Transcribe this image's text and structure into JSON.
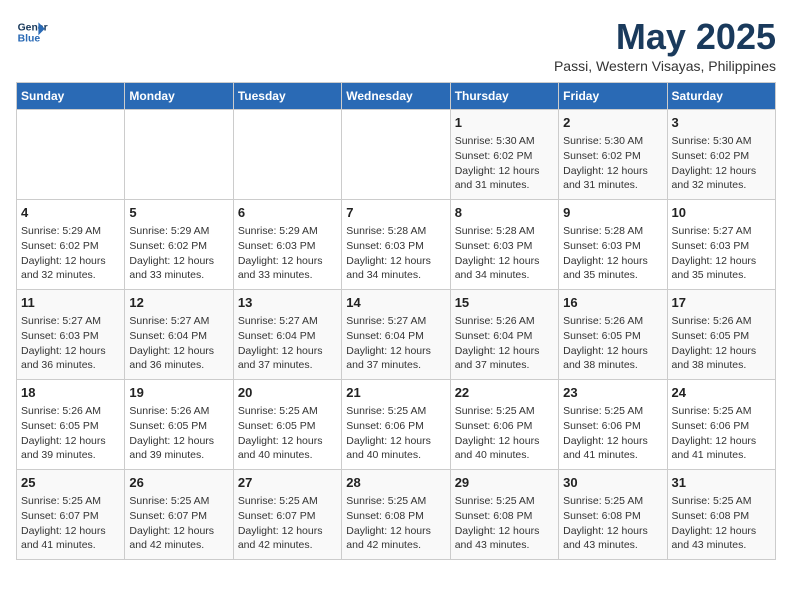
{
  "logo": {
    "line1": "General",
    "line2": "Blue"
  },
  "title": "May 2025",
  "subtitle": "Passi, Western Visayas, Philippines",
  "weekdays": [
    "Sunday",
    "Monday",
    "Tuesday",
    "Wednesday",
    "Thursday",
    "Friday",
    "Saturday"
  ],
  "weeks": [
    [
      {
        "day": "",
        "info": ""
      },
      {
        "day": "",
        "info": ""
      },
      {
        "day": "",
        "info": ""
      },
      {
        "day": "",
        "info": ""
      },
      {
        "day": "1",
        "info": "Sunrise: 5:30 AM\nSunset: 6:02 PM\nDaylight: 12 hours\nand 31 minutes."
      },
      {
        "day": "2",
        "info": "Sunrise: 5:30 AM\nSunset: 6:02 PM\nDaylight: 12 hours\nand 31 minutes."
      },
      {
        "day": "3",
        "info": "Sunrise: 5:30 AM\nSunset: 6:02 PM\nDaylight: 12 hours\nand 32 minutes."
      }
    ],
    [
      {
        "day": "4",
        "info": "Sunrise: 5:29 AM\nSunset: 6:02 PM\nDaylight: 12 hours\nand 32 minutes."
      },
      {
        "day": "5",
        "info": "Sunrise: 5:29 AM\nSunset: 6:02 PM\nDaylight: 12 hours\nand 33 minutes."
      },
      {
        "day": "6",
        "info": "Sunrise: 5:29 AM\nSunset: 6:03 PM\nDaylight: 12 hours\nand 33 minutes."
      },
      {
        "day": "7",
        "info": "Sunrise: 5:28 AM\nSunset: 6:03 PM\nDaylight: 12 hours\nand 34 minutes."
      },
      {
        "day": "8",
        "info": "Sunrise: 5:28 AM\nSunset: 6:03 PM\nDaylight: 12 hours\nand 34 minutes."
      },
      {
        "day": "9",
        "info": "Sunrise: 5:28 AM\nSunset: 6:03 PM\nDaylight: 12 hours\nand 35 minutes."
      },
      {
        "day": "10",
        "info": "Sunrise: 5:27 AM\nSunset: 6:03 PM\nDaylight: 12 hours\nand 35 minutes."
      }
    ],
    [
      {
        "day": "11",
        "info": "Sunrise: 5:27 AM\nSunset: 6:03 PM\nDaylight: 12 hours\nand 36 minutes."
      },
      {
        "day": "12",
        "info": "Sunrise: 5:27 AM\nSunset: 6:04 PM\nDaylight: 12 hours\nand 36 minutes."
      },
      {
        "day": "13",
        "info": "Sunrise: 5:27 AM\nSunset: 6:04 PM\nDaylight: 12 hours\nand 37 minutes."
      },
      {
        "day": "14",
        "info": "Sunrise: 5:27 AM\nSunset: 6:04 PM\nDaylight: 12 hours\nand 37 minutes."
      },
      {
        "day": "15",
        "info": "Sunrise: 5:26 AM\nSunset: 6:04 PM\nDaylight: 12 hours\nand 37 minutes."
      },
      {
        "day": "16",
        "info": "Sunrise: 5:26 AM\nSunset: 6:05 PM\nDaylight: 12 hours\nand 38 minutes."
      },
      {
        "day": "17",
        "info": "Sunrise: 5:26 AM\nSunset: 6:05 PM\nDaylight: 12 hours\nand 38 minutes."
      }
    ],
    [
      {
        "day": "18",
        "info": "Sunrise: 5:26 AM\nSunset: 6:05 PM\nDaylight: 12 hours\nand 39 minutes."
      },
      {
        "day": "19",
        "info": "Sunrise: 5:26 AM\nSunset: 6:05 PM\nDaylight: 12 hours\nand 39 minutes."
      },
      {
        "day": "20",
        "info": "Sunrise: 5:25 AM\nSunset: 6:05 PM\nDaylight: 12 hours\nand 40 minutes."
      },
      {
        "day": "21",
        "info": "Sunrise: 5:25 AM\nSunset: 6:06 PM\nDaylight: 12 hours\nand 40 minutes."
      },
      {
        "day": "22",
        "info": "Sunrise: 5:25 AM\nSunset: 6:06 PM\nDaylight: 12 hours\nand 40 minutes."
      },
      {
        "day": "23",
        "info": "Sunrise: 5:25 AM\nSunset: 6:06 PM\nDaylight: 12 hours\nand 41 minutes."
      },
      {
        "day": "24",
        "info": "Sunrise: 5:25 AM\nSunset: 6:06 PM\nDaylight: 12 hours\nand 41 minutes."
      }
    ],
    [
      {
        "day": "25",
        "info": "Sunrise: 5:25 AM\nSunset: 6:07 PM\nDaylight: 12 hours\nand 41 minutes."
      },
      {
        "day": "26",
        "info": "Sunrise: 5:25 AM\nSunset: 6:07 PM\nDaylight: 12 hours\nand 42 minutes."
      },
      {
        "day": "27",
        "info": "Sunrise: 5:25 AM\nSunset: 6:07 PM\nDaylight: 12 hours\nand 42 minutes."
      },
      {
        "day": "28",
        "info": "Sunrise: 5:25 AM\nSunset: 6:08 PM\nDaylight: 12 hours\nand 42 minutes."
      },
      {
        "day": "29",
        "info": "Sunrise: 5:25 AM\nSunset: 6:08 PM\nDaylight: 12 hours\nand 43 minutes."
      },
      {
        "day": "30",
        "info": "Sunrise: 5:25 AM\nSunset: 6:08 PM\nDaylight: 12 hours\nand 43 minutes."
      },
      {
        "day": "31",
        "info": "Sunrise: 5:25 AM\nSunset: 6:08 PM\nDaylight: 12 hours\nand 43 minutes."
      }
    ]
  ]
}
